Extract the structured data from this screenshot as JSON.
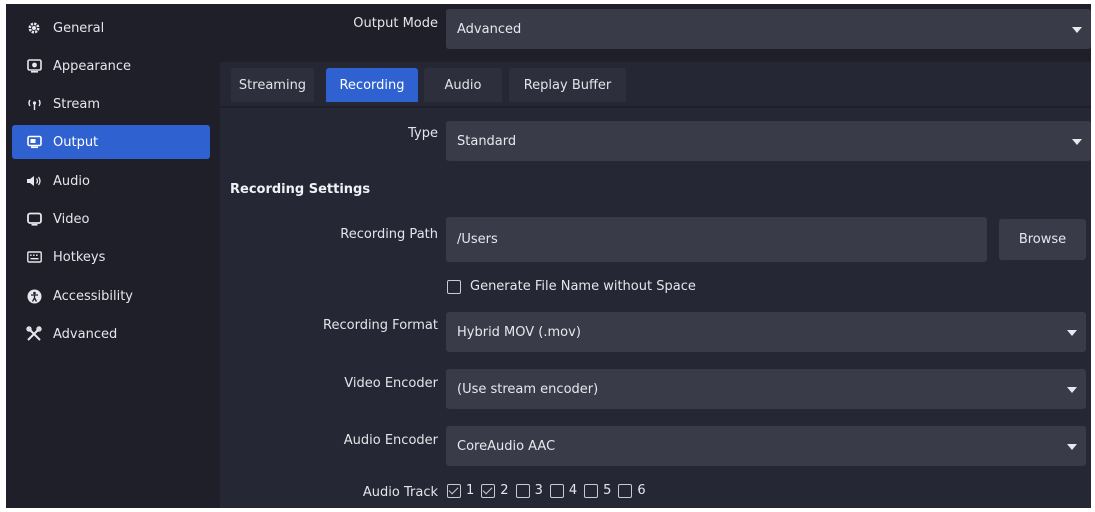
{
  "sidebar": {
    "items": [
      {
        "label": "General",
        "icon": "gear-icon"
      },
      {
        "label": "Appearance",
        "icon": "appearance-icon"
      },
      {
        "label": "Stream",
        "icon": "antenna-icon"
      },
      {
        "label": "Output",
        "icon": "output-icon",
        "active": true
      },
      {
        "label": "Audio",
        "icon": "speaker-icon"
      },
      {
        "label": "Video",
        "icon": "monitor-icon"
      },
      {
        "label": "Hotkeys",
        "icon": "keyboard-icon"
      },
      {
        "label": "Accessibility",
        "icon": "accessibility-icon"
      },
      {
        "label": "Advanced",
        "icon": "tools-icon"
      }
    ]
  },
  "output_mode": {
    "label": "Output Mode",
    "value": "Advanced"
  },
  "tabs": [
    {
      "label": "Streaming"
    },
    {
      "label": "Recording",
      "active": true
    },
    {
      "label": "Audio"
    },
    {
      "label": "Replay Buffer"
    }
  ],
  "type": {
    "label": "Type",
    "value": "Standard"
  },
  "recording_settings": {
    "title": "Recording Settings",
    "path": {
      "label": "Recording Path",
      "value": "/Users",
      "browse_label": "Browse"
    },
    "generate_filename": {
      "label": "Generate File Name without Space",
      "checked": false
    },
    "format": {
      "label": "Recording Format",
      "value": "Hybrid MOV (.mov)"
    },
    "video_encoder": {
      "label": "Video Encoder",
      "value": "(Use stream encoder)"
    },
    "audio_encoder": {
      "label": "Audio Encoder",
      "value": "CoreAudio AAC"
    },
    "audio_track": {
      "label": "Audio Track",
      "tracks": [
        {
          "num": "1",
          "checked": true
        },
        {
          "num": "2",
          "checked": true
        },
        {
          "num": "3",
          "checked": false
        },
        {
          "num": "4",
          "checked": false
        },
        {
          "num": "5",
          "checked": false
        },
        {
          "num": "6",
          "checked": false
        }
      ]
    }
  },
  "colors": {
    "accent": "#2f61d0",
    "background": "#1e1f29",
    "panel": "#262734",
    "field": "#3a3b49"
  }
}
